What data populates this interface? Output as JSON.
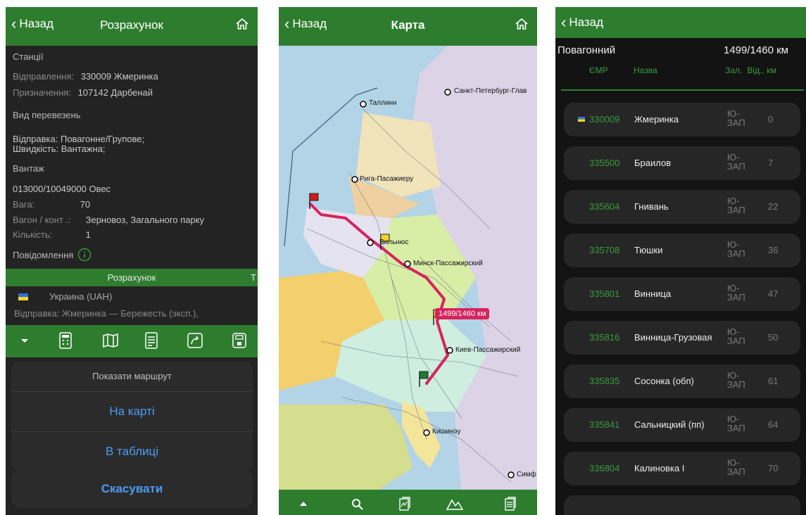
{
  "colors": {
    "accent": "#2e7d2f",
    "link": "#4a9cf5",
    "route": "#d7235e",
    "green_text": "#3a9b3d"
  },
  "p1": {
    "back": "Назад",
    "title": "Розрахунок",
    "stations_header": "Станції",
    "departure_label": "Відправлення:",
    "departure_value": "330009 Жмеринка",
    "destination_label": "Призначення:",
    "destination_value": "107142 Дарбенай",
    "transport_header": "Вид перевезень",
    "shipment": "Відправка: Повагонне/Групове;",
    "speed": "Швидкість: Вантажна;",
    "cargo_header": "Вантаж",
    "cargo_code": "013000/10049000 Овес",
    "weight_label": "Вага:",
    "weight_value": "70",
    "wagon_label": "Вагон / конт .:",
    "wagon_value": "Зерновоз, Загального парку",
    "qty_label": "Кількість:",
    "qty_value": "1",
    "messages": "Повідомлення",
    "calc_bar": "Розрахунок",
    "calc_bar_right": "Т",
    "country": "Украина (UAH)",
    "shipment_line": "Відправка:  Жмеринка — Бережесть (эксп.),",
    "sheet_title": "Показати маршрут",
    "on_map": "На карті",
    "in_table": "В таблиці",
    "cancel": "Скасувати"
  },
  "p2": {
    "back": "Назад",
    "title": "Карта",
    "route_badge": "1499/1460 км",
    "cities": [
      "Санкт-Петербург-Глав",
      "Таллинн",
      "Рига-Пасажиеру",
      "Вильнюс",
      "Минск-Пассажирский",
      "Киев-Пассажирский",
      "Кишинэу",
      "Симф"
    ],
    "toolbar_icons": [
      "up-arrow-icon",
      "search-icon",
      "chart-doc-icon",
      "mountain-icon",
      "layers-doc-icon"
    ]
  },
  "p3": {
    "back": "Назад",
    "summary_label": "Повагонний",
    "summary_value": "1499/1460 км",
    "col_code": "ЄМР",
    "col_name": "Назва",
    "col_rail": "Зал.",
    "col_km": "Від., км",
    "rows": [
      {
        "code": "330009",
        "name": "Жмеринка",
        "rail": "Ю-ЗАП",
        "km": "0"
      },
      {
        "code": "335500",
        "name": "Браилов",
        "rail": "Ю-ЗАП",
        "km": "7"
      },
      {
        "code": "335604",
        "name": "Гнивань",
        "rail": "Ю-ЗАП",
        "km": "22"
      },
      {
        "code": "335708",
        "name": "Тюшки",
        "rail": "Ю-ЗАП",
        "km": "36"
      },
      {
        "code": "335801",
        "name": "Винница",
        "rail": "Ю-ЗАП",
        "km": "47"
      },
      {
        "code": "335816",
        "name": "Винница-Грузовая",
        "rail": "Ю-ЗАП",
        "km": "50"
      },
      {
        "code": "335835",
        "name": "Сосонка (обп)",
        "rail": "Ю-ЗАП",
        "km": "61"
      },
      {
        "code": "335841",
        "name": "Сальницкий (пп)",
        "rail": "Ю-ЗАП",
        "km": "64"
      },
      {
        "code": "336804",
        "name": "Калиновка I",
        "rail": "Ю-ЗАП",
        "km": "70"
      }
    ]
  }
}
